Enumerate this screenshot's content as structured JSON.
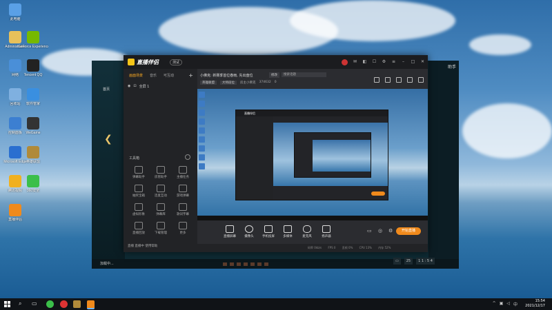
{
  "desktop": {
    "icons": [
      {
        "label": "此电脑",
        "icon": "computer-icon",
        "color": "#5aa0e6"
      },
      {
        "label": "Administrator",
        "icon": "user-folder-icon",
        "color": "#e8c15a"
      },
      {
        "label": "网络",
        "icon": "network-icon",
        "color": "#4a8fd8"
      },
      {
        "label": "回收站",
        "icon": "recycle-bin-icon",
        "color": "#7fb0e0"
      },
      {
        "label": "控制面板",
        "icon": "control-panel-icon",
        "color": "#3c7fd1"
      },
      {
        "label": "Microsoft Edge",
        "icon": "browser-icon",
        "color": "#2a6fd0"
      },
      {
        "label": "软件管家",
        "icon": "store-icon",
        "color": "#3a8fe0"
      },
      {
        "label": "Tencent QQ",
        "icon": "qq-icon",
        "color": "#222222"
      },
      {
        "label": "GeForce Experience",
        "icon": "nvidia-icon",
        "color": "#76b900"
      },
      {
        "label": "腾讯视频",
        "icon": "video-icon",
        "color": "#f0b020"
      },
      {
        "label": "英雄联盟",
        "icon": "lol-icon",
        "color": "#b08a3a"
      },
      {
        "label": "360安全",
        "icon": "security-icon",
        "color": "#3bbf4a"
      },
      {
        "label": "WeGame",
        "icon": "wegame-icon",
        "color": "#333333"
      },
      {
        "label": "直播伴侣",
        "icon": "live-icon",
        "color": "#f08a1c"
      }
    ]
  },
  "game_window": {
    "title_right": "助手",
    "left_tab": "首页",
    "footer_text": "加载中...",
    "bottom_right": [
      "25",
      "1 1 : 5 4"
    ]
  },
  "app": {
    "title": "直播伴侣",
    "version_badge": "测试",
    "side_tabs": [
      "画面场景",
      "音乐",
      "可互动"
    ],
    "scene_label": "全屏 1",
    "tools_title": "工具箱",
    "tools": [
      {
        "label": "弹幕助手",
        "icon": "danmaku-icon"
      },
      {
        "label": "房管助手",
        "icon": "admin-icon"
      },
      {
        "label": "主播任务",
        "icon": "task-icon"
      },
      {
        "label": "抽奖宝箱",
        "icon": "lottery-icon"
      },
      {
        "label": "连麦互动",
        "icon": "cohost-icon"
      },
      {
        "label": "游戏弹幕",
        "icon": "game-danmaku-icon"
      },
      {
        "label": "虚拟形象",
        "icon": "avatar-icon"
      },
      {
        "label": "弹幕库",
        "icon": "library-icon"
      },
      {
        "label": "歌词字幕",
        "icon": "lyrics-icon"
      },
      {
        "label": "直播回放",
        "icon": "replay-icon"
      },
      {
        "label": "下载管理",
        "icon": "download-icon"
      },
      {
        "label": "更多",
        "icon": "more-icon"
      }
    ],
    "footer": "直播 直播中 使用帮助",
    "room": {
      "title": "小佛克: 新赛季首位春雨, 先出盘位",
      "edit_label": "修改",
      "input_placeholder": "搜索话题",
      "category": "英雄联盟",
      "category_tag": "大师段位",
      "viewers": "28000",
      "sub_items": [
        "英雄联盟",
        "房主小佛克",
        "374632",
        "0"
      ]
    },
    "controls": [
      {
        "label": "直播屏幕",
        "icon": "screen-icon"
      },
      {
        "label": "摄像头",
        "icon": "camera-icon"
      },
      {
        "label": "手机投屏",
        "icon": "phone-cast-icon"
      },
      {
        "label": "多媒体",
        "icon": "media-icon"
      },
      {
        "label": "麦克风",
        "icon": "mic-icon"
      },
      {
        "label": "扬声器",
        "icon": "speaker-icon"
      }
    ],
    "go_live": "开始直播",
    "status": [
      "码率 0kb/s",
      "FPS 0",
      "丢帧 0%",
      "CPU 13%",
      "内存 52%",
      "帧率 60"
    ]
  },
  "taskbar": {
    "time": "15:54",
    "date": "2021/12/17",
    "tray_icons": [
      "up-arrow-icon",
      "network-icon",
      "volume-icon",
      "ime-icon"
    ]
  }
}
